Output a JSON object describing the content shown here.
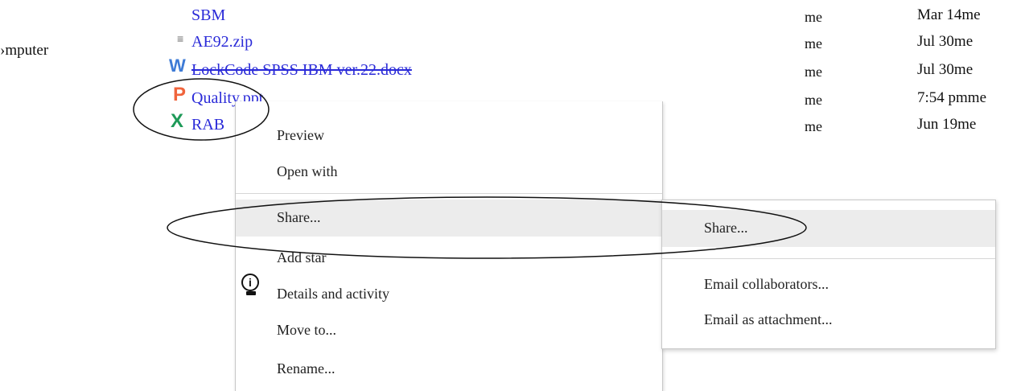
{
  "sidebar": {
    "label": "›mputer"
  },
  "files": [
    {
      "icon": "",
      "name": "SBM",
      "owner": "me",
      "modified": "Mar 14me"
    },
    {
      "icon": "≡",
      "name": "AE92.zip",
      "owner": "me",
      "modified": "Jul 30me"
    },
    {
      "icon": "W",
      "name": "LockCode SPSS IBM ver.22.docx",
      "owner": "me",
      "modified": "Jul 30me"
    },
    {
      "icon": "P",
      "name": "Quality.ppt",
      "owner": "me",
      "modified": "7:54 pmme"
    },
    {
      "icon": "X",
      "name": "RAB",
      "owner": "me",
      "modified": "Jun 19me"
    }
  ],
  "context_menu": {
    "items": [
      {
        "label": "Preview"
      },
      {
        "label": "Open with"
      },
      {
        "label": "Share..."
      },
      {
        "label": "Add star"
      },
      {
        "label": "Details and activity"
      },
      {
        "label": "Move to..."
      },
      {
        "label": "Rename..."
      }
    ]
  },
  "submenu": {
    "items": [
      {
        "label": "Share..."
      },
      {
        "label": "Email collaborators..."
      },
      {
        "label": "Email as attachment..."
      }
    ]
  },
  "icons": {
    "zip": "zip-file-icon",
    "word": "word-doc-icon",
    "powerpoint": "powerpoint-icon",
    "excel": "excel-icon",
    "info": "info-icon"
  },
  "colors": {
    "link": "#2a2ad8",
    "word": "#3e7bd6",
    "powerpoint": "#f0643c",
    "excel": "#1e9a58",
    "highlight": "#ececec"
  }
}
